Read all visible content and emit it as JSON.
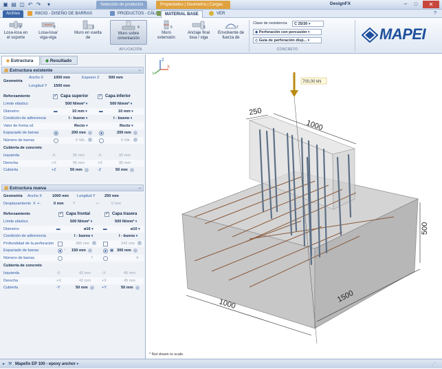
{
  "titlebar": {
    "app_name": "DesignFX",
    "context1": "Selección de productos",
    "context2": "Propiedades | Geometría | Cargas"
  },
  "tabs": {
    "file": "Archivo",
    "tab1": "INICIO - DISEÑO DE BARRAS",
    "tab2": "PRODUCTOS - CÁLCULO",
    "tab3": "MATERIAL BASE",
    "tab4": "VER"
  },
  "ribbon": {
    "buttons": [
      {
        "label": "Losa-losa en el soporte",
        "num": "1"
      },
      {
        "label": "Losa-losa/ viga-viga",
        "num": "2"
      },
      {
        "label": "Muro en vuelta de",
        "num": "3"
      },
      {
        "label": "Muro sobre cimentación",
        "num": "4"
      },
      {
        "label": "Muro extensión",
        "num": "5"
      },
      {
        "label": "Anclaje final losa / viga",
        "num": "6"
      },
      {
        "label": "Envolvente de fuerza de",
        "num": "7"
      }
    ],
    "group_application": "APLICACIÓN",
    "group_concrete": "CONCRETO",
    "resistance_label": "Clase de resistencia",
    "resistance_value": "C 25/30",
    "drilling_value": "Perforación con percusión",
    "guide_value": "Guía de perforación disp...",
    "brand": "MAPEI",
    "brand_color": "#1f4f9c"
  },
  "panel": {
    "tab_structure": "Estructura",
    "tab_result": "Resultado",
    "existing": {
      "header": "Estructura existente",
      "geometry": "Geometría",
      "width_x_label": "Ancho X",
      "width_x": "1000 mm",
      "thick_z_label": "Espesor Z",
      "thick_z": "500 mm",
      "length_y_label": "Longitud Y",
      "length_y": "1500 mm",
      "reinforcement": "Reforzamiento",
      "top_layer": "Capa superior",
      "bottom_layer": "Capa inferior",
      "rows": [
        {
          "label": "Límite elástico",
          "v1": "500 N/mm²",
          "v2": "500 N/mm²"
        },
        {
          "label": "Diámetro",
          "v1": "10 mm",
          "v2": "10 mm"
        },
        {
          "label": "Condición de adherencia",
          "v1": "I - bueno",
          "v2": "I - bueno"
        },
        {
          "label": "Valor de forma α1",
          "v1": "Recto",
          "v2": "Recto"
        },
        {
          "label": "Espaciado de barras",
          "v1": "200 mm",
          "v2": "200 mm"
        },
        {
          "label": "Número de barras",
          "v1": "5 Stk.",
          "v2": "5 Stk."
        }
      ],
      "cover_header": "Cubierta de concreto",
      "cover_rows": [
        {
          "label": "Izquierda",
          "s1": "-X",
          "v1": "95 mm",
          "s2": "-X",
          "v2": "95 mm"
        },
        {
          "label": "Derecha",
          "s1": "+X",
          "v1": "95 mm",
          "s2": "+X",
          "v2": "95 mm"
        },
        {
          "label": "Cubierta",
          "s1": "+Z",
          "v1": "50 mm",
          "s2": "-Z",
          "v2": "50 mm"
        }
      ]
    },
    "new": {
      "header": "Estructura nueva",
      "geometry": "Geometría",
      "width_x_label": "Ancho X",
      "width_x": "1000 mm",
      "length_y_label": "Longitud Y",
      "length_y": "250 mm",
      "disp_label": "Desplazamiento",
      "disp_x_axis": "X",
      "disp_x_sign": "+-",
      "disp_x": "0 mm",
      "disp_y_axis": "Y",
      "disp_y_sign": "+-",
      "disp_y": "0 mm",
      "reinforcement": "Reforzamiento",
      "front_layer": "Capa frontal",
      "back_layer": "Capa trasera",
      "rows": [
        {
          "label": "Límite elástico",
          "v1": "500 N/mm²",
          "v2": "500 N/mm²"
        },
        {
          "label": "Diámetro",
          "v1": "ø16",
          "v2": "ø10"
        },
        {
          "label": "Condición de adherencia",
          "v1": "I - bueno",
          "v2": "I - bueno"
        },
        {
          "label": "Profundidad de la perforación",
          "v1": "386 mm",
          "v2": "242 mm"
        },
        {
          "label": "Espaciado de barras",
          "v1": "150 mm",
          "v2": "300 mm"
        },
        {
          "label": "Número de barras",
          "v1": "7",
          "v2": "4"
        }
      ],
      "cover_header": "Cubierta de concreto",
      "cover_rows": [
        {
          "label": "Izquierda",
          "s1": "-X",
          "v1": "42 mm",
          "s2": "-X",
          "v2": "45 mm"
        },
        {
          "label": "Derecha",
          "s1": "+X",
          "v1": "42 mm",
          "s2": "+X",
          "v2": "45 mm"
        },
        {
          "label": "Cubierta",
          "s1": "-Y",
          "v1": "50 mm",
          "s2": "+Y",
          "v2": "50 mm"
        }
      ]
    }
  },
  "view": {
    "load_label": "700,00 kN",
    "dim_250": "250",
    "dim_1000_top": "1000",
    "dim_500": "500",
    "dim_1500": "1500",
    "dim_1000_bottom": "1000",
    "footnote": "* Not drawn to scale.",
    "axis_x": "X",
    "axis_y": "Y",
    "axis_z": "Z"
  },
  "status": {
    "product": "Mapefix EP 100 - epoxy anchor"
  }
}
